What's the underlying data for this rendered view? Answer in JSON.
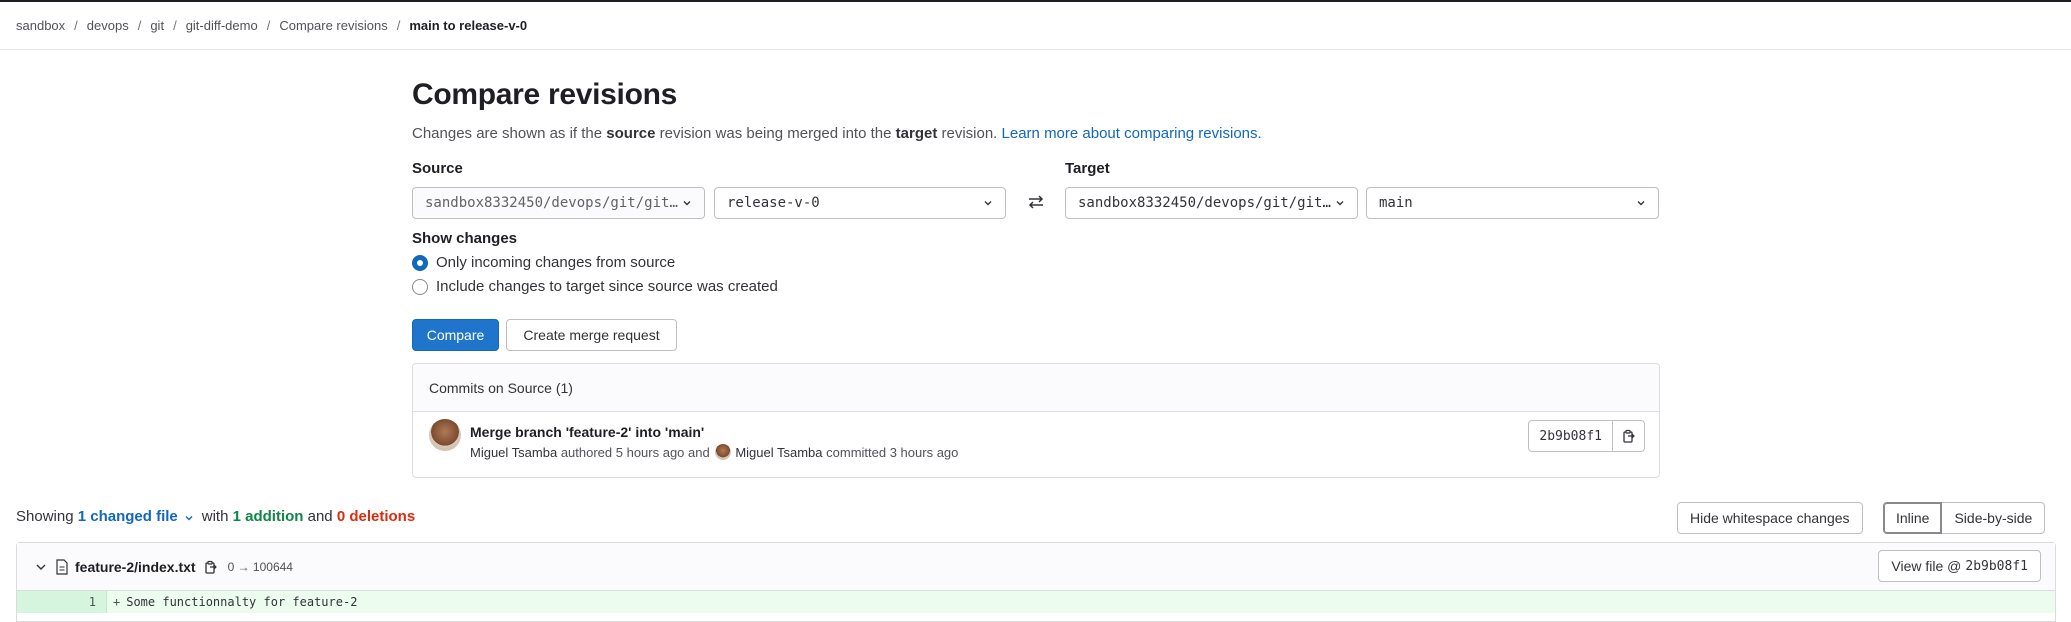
{
  "breadcrumb": [
    "sandbox",
    "devops",
    "git",
    "git-diff-demo",
    "Compare revisions",
    "main to release-v-0"
  ],
  "page": {
    "title": "Compare revisions",
    "desc_1": "Changes are shown as if the ",
    "desc_source": "source",
    "desc_2": " revision was being merged into the ",
    "desc_target": "target",
    "desc_3": " revision. ",
    "desc_link": "Learn more about comparing revisions."
  },
  "source": {
    "label": "Source",
    "project": "sandbox8332450/devops/git/git-diff-demo",
    "branch": "release-v-0"
  },
  "target": {
    "label": "Target",
    "project": "sandbox8332450/devops/git/git-diff-demo",
    "branch": "main"
  },
  "show_changes": {
    "label": "Show changes",
    "options": [
      "Only incoming changes from source",
      "Include changes to target since source was created"
    ],
    "selected": 0
  },
  "actions": {
    "compare": "Compare",
    "create_mr": "Create merge request"
  },
  "commits": {
    "header": "Commits on Source (1)",
    "items": [
      {
        "title": "Merge branch 'feature-2' into 'main'",
        "author": "Miguel Tsamba",
        "authored": " authored 5 hours ago and ",
        "committer": "Miguel Tsamba",
        "committed": " committed 3 hours ago",
        "sha": "2b9b08f1"
      }
    ]
  },
  "diff_summary": {
    "showing": "Showing",
    "changed": "1 changed file",
    "with": "with",
    "additions": "1 addition",
    "and": "and",
    "deletions": "0 deletions"
  },
  "view_options": {
    "whitespace": "Hide whitespace changes",
    "inline": "Inline",
    "side_by_side": "Side-by-side"
  },
  "file": {
    "path": "feature-2/index.txt",
    "mode": "0 → 100644",
    "view_label": "View file @",
    "view_sha": "2b9b08f1",
    "lines": [
      {
        "number": "1",
        "prefix": "+",
        "text": "Some functionnalty for feature-2"
      }
    ]
  },
  "colors": {
    "primary": "#1f75cb",
    "link": "#1068bf",
    "addition": "#108548",
    "deletion": "#dd2b0e"
  }
}
